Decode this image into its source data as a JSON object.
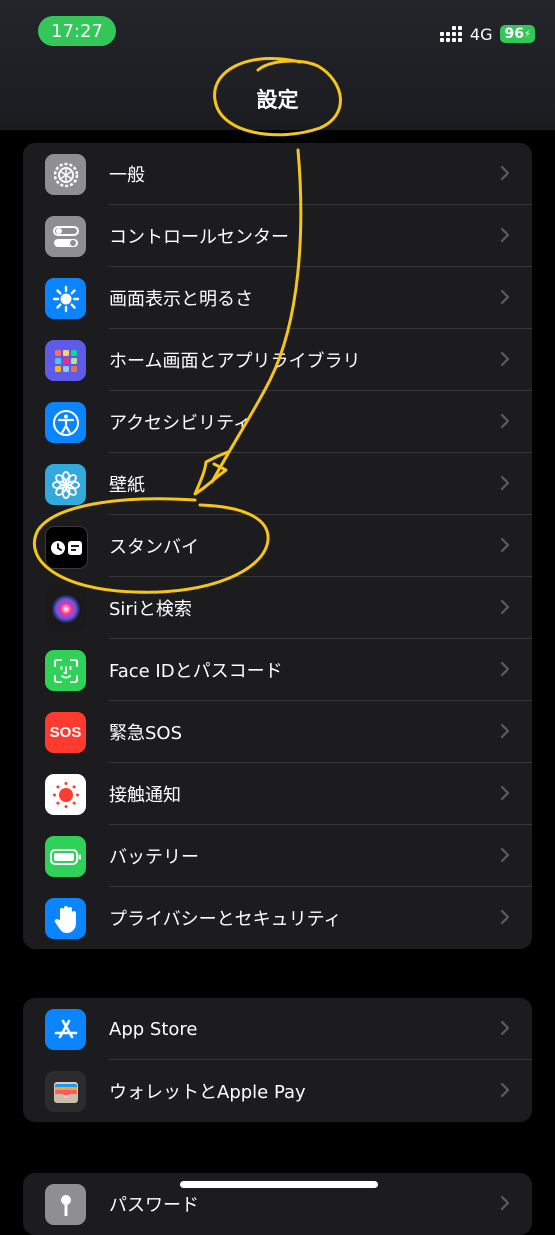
{
  "status": {
    "time": "17:27",
    "network": "4G",
    "battery": "96"
  },
  "header": {
    "title": "設定"
  },
  "groups": [
    {
      "items": [
        {
          "label": "一般",
          "icon": "gear-icon",
          "color": "#8e8e93"
        },
        {
          "label": "コントロールセンター",
          "icon": "toggles-icon",
          "color": "#8e8e93"
        },
        {
          "label": "画面表示と明るさ",
          "icon": "sun-icon",
          "color": "#0a84ff"
        },
        {
          "label": "ホーム画面とアプリライブラリ",
          "icon": "app-grid-icon",
          "color": "#5e5ce6"
        },
        {
          "label": "アクセシビリティ",
          "icon": "accessibility-icon",
          "color": "#0a84ff"
        },
        {
          "label": "壁紙",
          "icon": "flower-icon",
          "color": "#34aadc"
        },
        {
          "label": "スタンバイ",
          "icon": "standby-icon",
          "color": "#000000"
        },
        {
          "label": "Siriと検索",
          "icon": "siri-icon",
          "color": "#1a1a1a"
        },
        {
          "label": "Face IDとパスコード",
          "icon": "faceid-icon",
          "color": "#30d158"
        },
        {
          "label": "緊急SOS",
          "icon": "sos-icon",
          "icon_text": "SOS",
          "color": "#ff3b30"
        },
        {
          "label": "接触通知",
          "icon": "exposure-icon",
          "color": "#ffffff"
        },
        {
          "label": "バッテリー",
          "icon": "battery-icon",
          "color": "#30d158"
        },
        {
          "label": "プライバシーとセキュリティ",
          "icon": "hand-icon",
          "color": "#0a84ff"
        }
      ]
    },
    {
      "items": [
        {
          "label": "App Store",
          "icon": "appstore-icon",
          "color": "#0a84ff"
        },
        {
          "label": "ウォレットとApple Pay",
          "icon": "wallet-icon",
          "color": "#2c2c2e"
        }
      ]
    },
    {
      "items": [
        {
          "label": "パスワード",
          "icon": "key-icon",
          "color": "#8e8e93"
        }
      ]
    }
  ],
  "annotation_color": "#f5c518"
}
